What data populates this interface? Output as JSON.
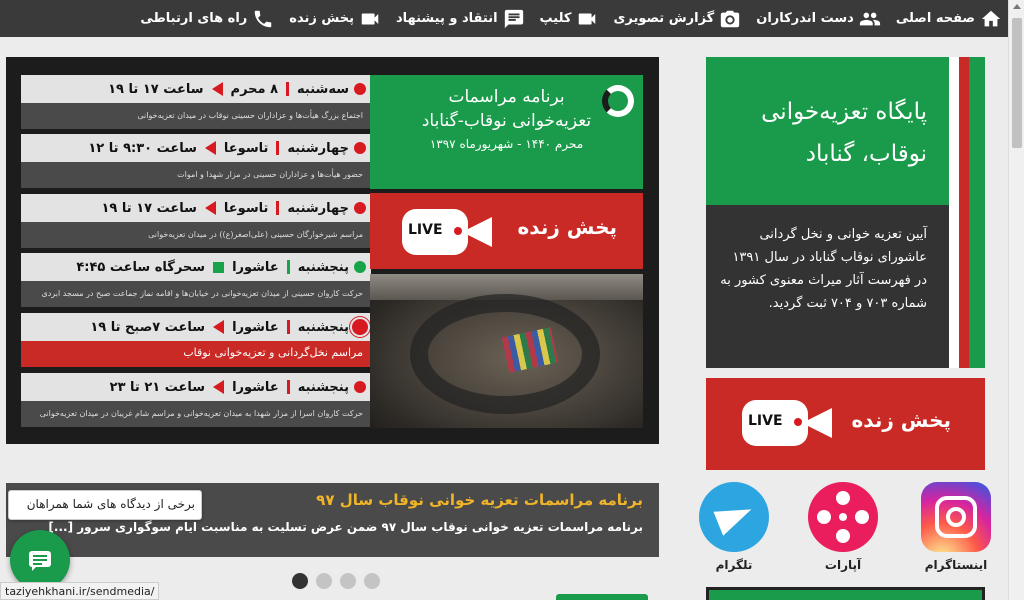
{
  "nav": {
    "items": [
      {
        "label": "صفحه اصلی",
        "icon": "home-icon"
      },
      {
        "label": "دست اندرکاران",
        "icon": "group-icon"
      },
      {
        "label": "گزارش تصویری",
        "icon": "camera-icon"
      },
      {
        "label": "کلیپ",
        "icon": "video-icon"
      },
      {
        "label": "انتقاد و پیشنهاد",
        "icon": "message-icon"
      },
      {
        "label": "پخش زنده",
        "icon": "video-icon"
      },
      {
        "label": "راه های ارتباطی",
        "icon": "phone-icon"
      }
    ]
  },
  "schedule": [
    {
      "text": "سه‌شنبه ▌ ۸ محرم ◀ ساعت ۱۷ تا ۱۹",
      "day": "سه‌شنبه",
      "date": "۸ محرم",
      "time": "ساعت ۱۷ تا ۱۹",
      "desc": "اجتماع بزرگ هیأت‌ها و عزاداران حسینی نوقاب در میدان تعزیه‌خوانی",
      "dot": "red",
      "marker": "triangle"
    },
    {
      "day": "چهارشنبه",
      "date": "تاسوعا",
      "time": "ساعت ۹:۳۰ تا ۱۲",
      "desc": "حضور هیأت‌ها و عزاداران حسینی در مزار شهدا و اموات",
      "dot": "red",
      "marker": "triangle"
    },
    {
      "day": "چهارشنبه",
      "date": "تاسوعا",
      "time": "ساعت ۱۷ تا ۱۹",
      "desc": "مراسم شیرخوارگان حسینی (علی‌اصغر(ع)) در میدان تعزیه‌خوانی",
      "dot": "red",
      "marker": "triangle"
    },
    {
      "day": "پنجشنبه",
      "date": "عاشورا",
      "time": "سحرگاه ساعت ۴:۴۵",
      "desc": "حرکت کاروان حسینی از میدان تعزیه‌خوانی در خیابان‌ها و اقامه نماز جماعت صبح در مسجد ابردی",
      "dot": "green",
      "marker": "square"
    },
    {
      "day": "پنجشنبه",
      "date": "عاشورا",
      "time": "ساعت ۷صبح تا ۱۹",
      "desc": "مراسم نخل‌گردانی و تعزیه‌خوانی نوقاب",
      "dot": "ring",
      "marker": "triangle",
      "highlight": true
    },
    {
      "day": "پنجشنبه",
      "date": "عاشورا",
      "time": "ساعت ۲۱ تا ۲۳",
      "desc": "حرکت کاروان اسرا از مزار شهدا به میدان تعزیه‌خوانی و مراسم شام غریبان در میدان تعزیه‌خوانی",
      "dot": "red",
      "marker": "triangle"
    }
  ],
  "program": {
    "line1": "برنامه مراسمات",
    "line2": "تعزیه‌خوانی نوقاب-گناباد",
    "line3": "محرم ۱۴۴۰ - شهریورماه ۱۳۹۷"
  },
  "live": {
    "label": "پخش زنده",
    "badge": "LIVE"
  },
  "news": {
    "title": "برنامه مراسمات تعزیه خوانی نوقاب سال ۹۷",
    "desc": "برنامه مراسمات تعزیه خوانی نوقاب سال ۹۷ ضمن عرض تسلیت به مناسبت ایام سوگواری سرور [...]"
  },
  "tooltip": "برخی از دیدگاه های شما همراهان",
  "status_url": "taziyehkhani.ir/sendmedia/",
  "slider": {
    "pages": 4,
    "active_index": 0
  },
  "sidebar": {
    "title": "پایگاه تعزیه‌خوانی نوقاب، گناباد",
    "desc": "آیین تعزیه خوانی و نخل گردانی عاشورای نوقاب گناباد در سال ۱۳۹۱ در فهرست آثار میراث معنوی کشور به شماره ۷۰۳ و ۷۰۴ ثبت گردید.",
    "live_label": "پخش زنده"
  },
  "social": [
    {
      "label": "اینستاگرام",
      "icon": "instagram-icon"
    },
    {
      "label": "آپارات",
      "icon": "aparat-icon"
    },
    {
      "label": "تلگرام",
      "icon": "telegram-icon"
    }
  ],
  "colors": {
    "green": "#1a9b4b",
    "red": "#c92a25",
    "dark": "#333333",
    "nav": "#3a3a3a",
    "gold": "#f0b429"
  }
}
